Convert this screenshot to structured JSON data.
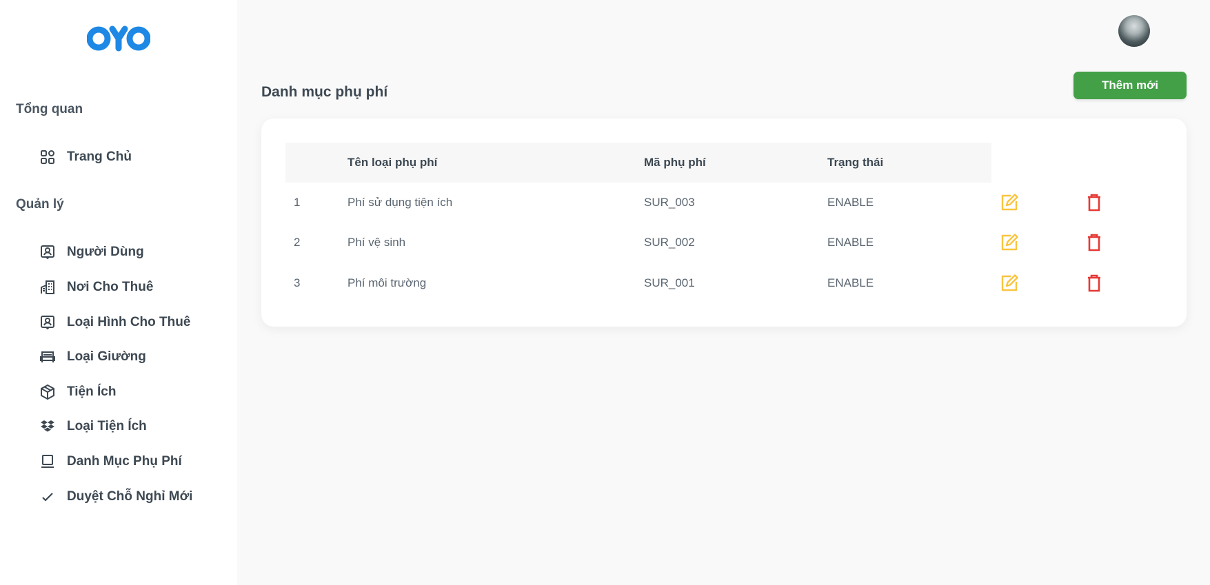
{
  "brand": {
    "logo_text": "OYO",
    "color": "#1e88e5"
  },
  "sidebar": {
    "sections": [
      {
        "title": "Tổng quan"
      },
      {
        "title": "Quản lý"
      }
    ],
    "items": [
      {
        "label": "Trang Chủ",
        "icon": "dashboard-grid-icon"
      },
      {
        "label": "Người Dùng",
        "icon": "user-badge-icon"
      },
      {
        "label": "Nơi Cho Thuê",
        "icon": "building-icon"
      },
      {
        "label": "Loại Hình Cho Thuê",
        "icon": "user-badge-icon"
      },
      {
        "label": "Loại Giường",
        "icon": "bed-icon"
      },
      {
        "label": "Tiện Ích",
        "icon": "box-icon"
      },
      {
        "label": "Loại Tiện Ích",
        "icon": "dropbox-icon"
      },
      {
        "label": "Danh Mục Phụ Phí",
        "icon": "laptop-icon"
      },
      {
        "label": "Duyệt Chỗ Nghỉ Mới",
        "icon": "check-icon"
      }
    ]
  },
  "header": {
    "avatar": "user-avatar"
  },
  "main": {
    "title": "Danh mục phụ phí",
    "add_button": "Thêm mới",
    "table": {
      "columns": [
        "",
        "Tên loại phụ phí",
        "Mã phụ phí",
        "Trạng thái"
      ],
      "rows": [
        {
          "index": "1",
          "name": "Phí sử dụng tiện ích",
          "code": "SUR_003",
          "status": "ENABLE"
        },
        {
          "index": "2",
          "name": "Phí vệ sinh",
          "code": "SUR_002",
          "status": "ENABLE"
        },
        {
          "index": "3",
          "name": "Phí môi trường",
          "code": "SUR_001",
          "status": "ENABLE"
        }
      ]
    }
  },
  "colors": {
    "accent_green": "#43a047",
    "edit_icon": "#f9c440",
    "delete_icon": "#e53935",
    "text_dark": "#3d4852"
  }
}
